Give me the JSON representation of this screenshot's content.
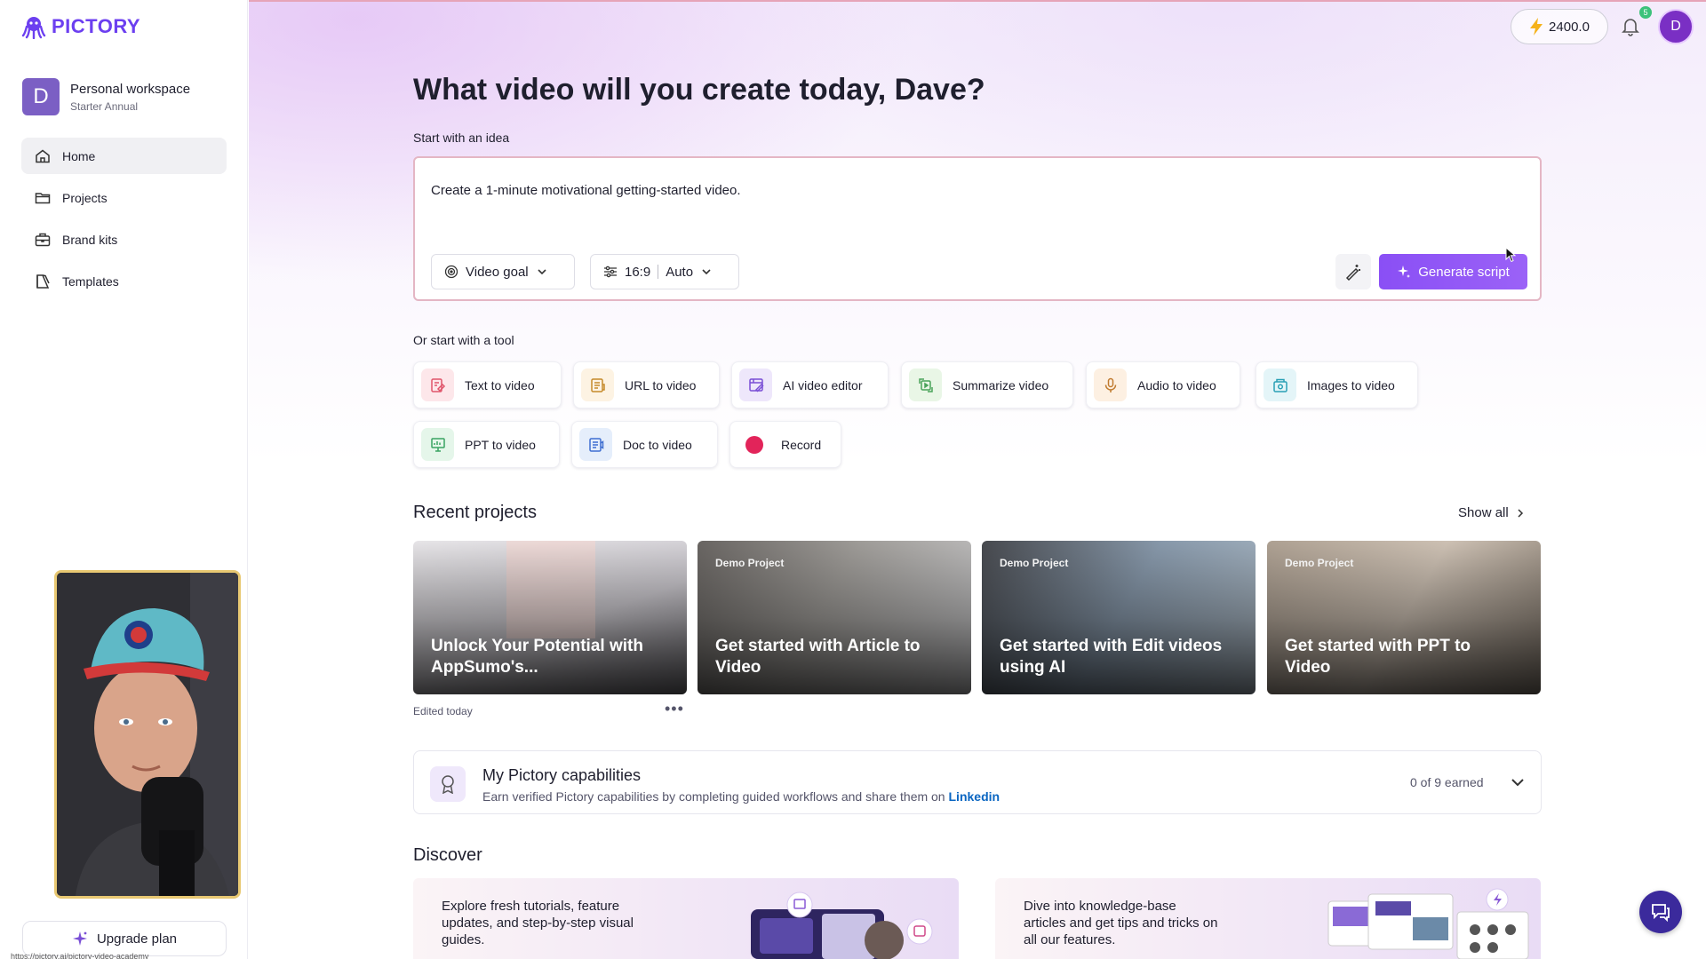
{
  "brand": {
    "name": "PICTORY",
    "accent": "#6c3ff0"
  },
  "workspace": {
    "initial": "D",
    "name": "Personal workspace",
    "plan": "Starter Annual"
  },
  "nav": [
    {
      "label": "Home",
      "icon": "home-icon",
      "active": true
    },
    {
      "label": "Projects",
      "icon": "folder-icon",
      "active": false
    },
    {
      "label": "Brand kits",
      "icon": "briefcase-icon",
      "active": false
    },
    {
      "label": "Templates",
      "icon": "templates-icon",
      "active": false
    }
  ],
  "upgrade": {
    "label": "Upgrade plan"
  },
  "status_url": "https://pictory.ai/pictory-video-academy",
  "topbar": {
    "credits": "2400.0",
    "notifications": "5",
    "user_initial": "D"
  },
  "headline": "What video will you create today, Dave?",
  "idea": {
    "label": "Start with an idea",
    "prompt": "Create a 1-minute motivational getting-started video.",
    "goal_label": "Video goal",
    "ratio": "16:9",
    "duration": "Auto",
    "generate_label": "Generate script"
  },
  "tools": {
    "label": "Or start with a tool",
    "items": [
      {
        "label": "Text to video",
        "icon": "text-video-icon",
        "bg": "#fde7ea",
        "fg": "#e0556b"
      },
      {
        "label": "URL to video",
        "icon": "url-video-icon",
        "bg": "#fdf3e3",
        "fg": "#c58a2a"
      },
      {
        "label": "AI video editor",
        "icon": "ai-editor-icon",
        "bg": "#eee7fb",
        "fg": "#7a4fd6"
      },
      {
        "label": "Summarize video",
        "icon": "summarize-icon",
        "bg": "#e9f6e6",
        "fg": "#4aa35a"
      },
      {
        "label": "Audio to video",
        "icon": "microphone-icon",
        "bg": "#fdf0e2",
        "fg": "#c07a2e"
      },
      {
        "label": "Images to video",
        "icon": "images-video-icon",
        "bg": "#e4f5f8",
        "fg": "#2aa0b5"
      },
      {
        "label": "PPT to video",
        "icon": "ppt-video-icon",
        "bg": "#e5f6ea",
        "fg": "#3aa362"
      },
      {
        "label": "Doc to video",
        "icon": "doc-video-icon",
        "bg": "#e5eefb",
        "fg": "#3f6fd1"
      },
      {
        "label": "Record",
        "icon": "record-icon",
        "bg": "#ffffff",
        "fg": "#e2245a"
      }
    ]
  },
  "recent": {
    "title": "Recent projects",
    "show_all": "Show all",
    "edited": "Edited today",
    "cards": [
      {
        "tag": "",
        "title": "Unlock Your Potential with AppSumo's..."
      },
      {
        "tag": "Demo Project",
        "title": "Get started with Article to Video"
      },
      {
        "tag": "Demo Project",
        "title": "Get started with Edit videos using AI"
      },
      {
        "tag": "Demo Project",
        "title": "Get started with PPT to Video"
      }
    ]
  },
  "capabilities": {
    "title": "My Pictory capabilities",
    "desc": "Earn verified Pictory capabilities by completing guided workflows and share them on",
    "linkedin": "Linkedin",
    "earned": "0 of 9 earned"
  },
  "discover": {
    "title": "Discover",
    "cards": [
      {
        "text": "Explore fresh tutorials, feature updates, and step-by-step visual guides."
      },
      {
        "text": "Dive into knowledge-base articles and get tips and tricks on all our features."
      }
    ]
  }
}
